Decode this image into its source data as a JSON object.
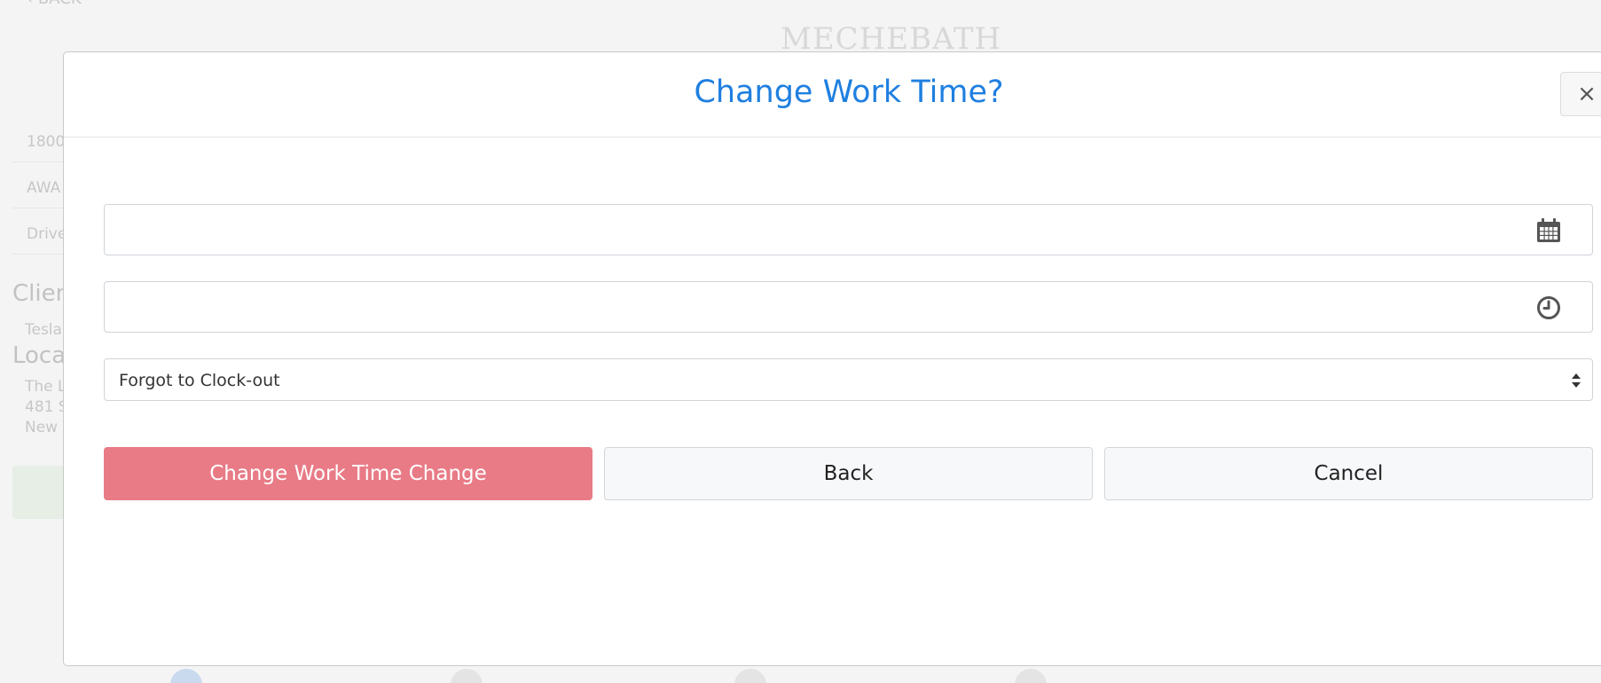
{
  "background": {
    "back_link": "‹ BACK",
    "logo_text": "MECHEBATH",
    "rows": [
      "1800",
      "AWA",
      "Drive"
    ],
    "client_heading": "Client",
    "client_value": "Tesla",
    "location_heading": "Location",
    "location_lines": [
      "The L",
      "481 S",
      "New"
    ]
  },
  "modal": {
    "title": "Change Work Time?",
    "close_label": "×",
    "date_field": {
      "value": "",
      "icon": "calendar-icon"
    },
    "time_field": {
      "value": "",
      "icon": "clock-icon"
    },
    "reason_select": {
      "selected": "Forgot to Clock-out"
    },
    "buttons": {
      "confirm": "Change Work Time Change",
      "back": "Back",
      "cancel": "Cancel"
    }
  },
  "colors": {
    "title": "#1f7fe0",
    "confirm_button": "#e87b86"
  }
}
